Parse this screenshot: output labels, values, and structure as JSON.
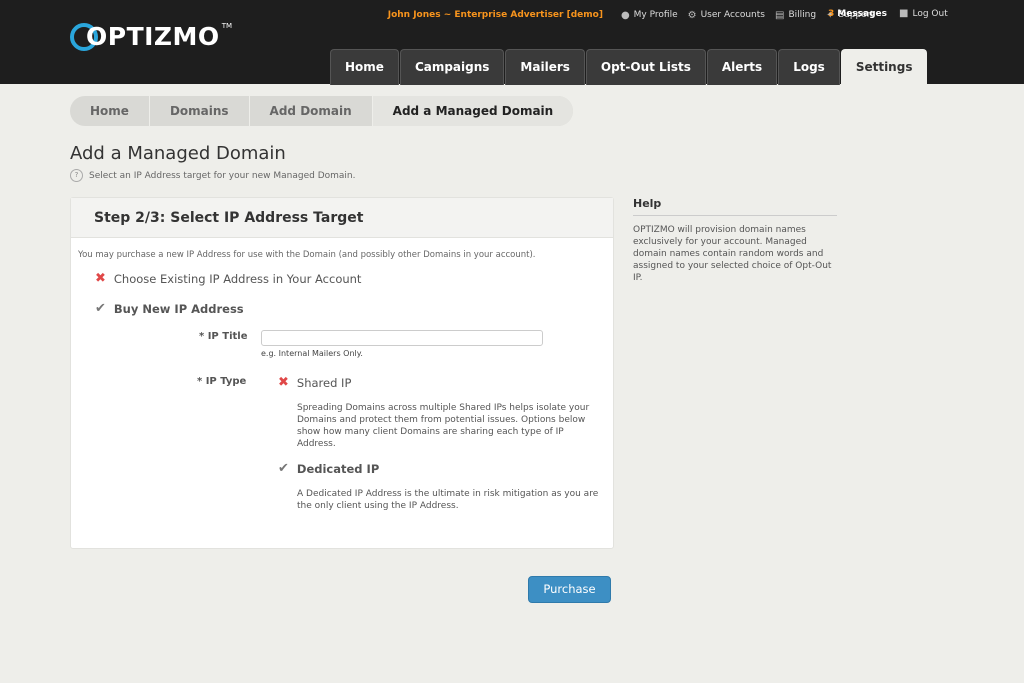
{
  "header": {
    "logo_text": "OPTIZMO",
    "logo_tm": "TM",
    "user": "John Jones ~ Enterprise Advertiser [demo]",
    "links": {
      "my_profile": "My Profile",
      "user_accounts": "User Accounts",
      "billing": "Billing",
      "support": "Support",
      "messages_count": "3",
      "messages": "Messages",
      "log_out": "Log Out"
    }
  },
  "nav": {
    "tabs": [
      {
        "label": "Home"
      },
      {
        "label": "Campaigns"
      },
      {
        "label": "Mailers"
      },
      {
        "label": "Opt-Out Lists"
      },
      {
        "label": "Alerts"
      },
      {
        "label": "Logs"
      },
      {
        "label": "Settings"
      }
    ],
    "active": "Settings"
  },
  "breadcrumb": [
    "Home",
    "Domains",
    "Add Domain",
    "Add a Managed Domain"
  ],
  "page": {
    "title": "Add a Managed Domain",
    "subtitle": "Select an IP Address target for your new Managed Domain."
  },
  "panel": {
    "heading": "Step 2/3: Select IP Address Target",
    "intro": "You may purchase a new IP Address for use with the Domain (and possibly other Domains in your account).",
    "option_existing": "Choose Existing IP Address in Your Account",
    "option_buy": "Buy New IP Address",
    "ip_title_label": "* IP Title",
    "ip_title_value": "",
    "ip_title_placeholder": "",
    "ip_title_hint": "e.g. Internal Mailers Only.",
    "ip_type_label": "* IP Type",
    "shared_label": "Shared IP",
    "shared_desc": "Spreading Domains across multiple Shared IPs helps isolate your Domains and protect them from potential issues. Options below show how many client Domains are sharing each type of IP Address.",
    "dedicated_label": "Dedicated IP",
    "dedicated_desc": "A Dedicated IP Address is the ultimate in risk mitigation as you are the only client using the IP Address."
  },
  "help": {
    "heading": "Help",
    "body": "OPTIZMO will provision domain names exclusively for your account. Managed domain names contain random words and assigned to your selected choice of Opt-Out IP."
  },
  "purchase_label": "Purchase",
  "colors": {
    "accent": "#3d8fc4",
    "brand_orange": "#f7941d",
    "error_x": "#e04848"
  }
}
